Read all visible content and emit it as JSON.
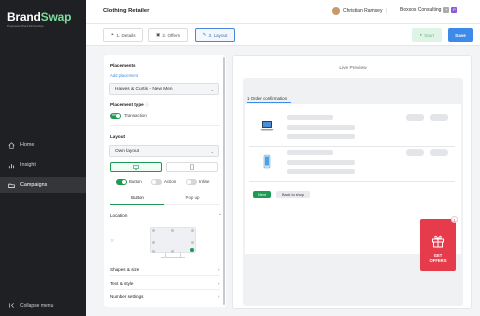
{
  "brand": {
    "name_a": "Brand",
    "name_b": "Swap",
    "tagline": "Progressive Brand Partnerships"
  },
  "sidebar": {
    "items": [
      {
        "label": "Home",
        "icon": "home-icon"
      },
      {
        "label": "Insight",
        "icon": "chart-icon"
      },
      {
        "label": "Campaigns",
        "icon": "folder-icon"
      }
    ],
    "collapse_label": "Collapse menu"
  },
  "header": {
    "title": "Clothing Retailer",
    "user_name": "Christian Ramsey",
    "org_name": "Boxsos Consulting",
    "org_badges": [
      "+",
      "P"
    ]
  },
  "steps": [
    {
      "label": "1. Details",
      "icon": "link-icon"
    },
    {
      "label": "2. Offers",
      "icon": "gift-icon"
    },
    {
      "label": "3. Layout",
      "icon": "pencil-icon"
    }
  ],
  "actions": {
    "start_label": "Start",
    "save_label": "Save"
  },
  "panel": {
    "placements_label": "Placements",
    "add_placement_label": "Add placement",
    "placement_value": "Hawes & Curtis - New Men",
    "placement_type_label": "Placement type",
    "placement_type_toggle": "Yes",
    "placement_type_value": "Transaction",
    "layout_label": "Layout",
    "layout_value": "Own layout",
    "options": [
      {
        "label": "Button",
        "on": true
      },
      {
        "label": "Action",
        "on": false
      },
      {
        "label": "Inline",
        "on": false
      }
    ],
    "tabs": [
      "Button",
      "Pop up"
    ],
    "location_label": "Location",
    "sections": [
      "Shapes & size",
      "Text & style",
      "Number settings"
    ]
  },
  "preview": {
    "title": "Live Preview",
    "tab_label": "1 Order confirmation",
    "next_label": "Next",
    "back_label": "Back to shop",
    "gift_line1": "GET",
    "gift_line2": "OFFERS",
    "gift_close": "1"
  },
  "colors": {
    "accent": "#1f9a55",
    "primary": "#3d8ae8",
    "gift": "#e63b4b",
    "sidebar": "#1f2023"
  }
}
